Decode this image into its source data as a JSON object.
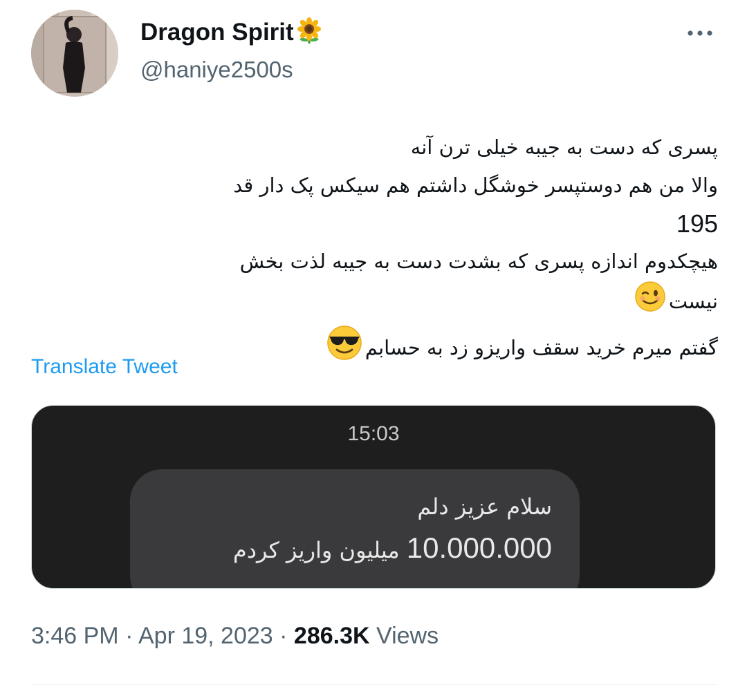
{
  "author": {
    "display_name": "Dragon Spirit",
    "handle": "@haniye2500s",
    "name_emoji": "sunflower-icon"
  },
  "tweet": {
    "lines": [
      "پسری که دست به جیبه خیلی ترن آنه",
      "والا من هم دوستپسر خوشگل داشتم هم سیکس پک دار قد",
      "195",
      "هیچکدوم اندازه پسری که  بشدت دست به جیبه لذت بخش",
      "نیست",
      "گفتم میرم خرید سقف واریزو  زد به حسابم"
    ],
    "emojis": [
      "winking-face-icon",
      "smiling-face-with-sunglasses-icon"
    ],
    "translate_label": "Translate Tweet"
  },
  "media": {
    "time": "15:03",
    "message_line1": "سلام عزیز دلم",
    "message_amount": "10.000.000",
    "message_rest": "میلیون واریز کردم"
  },
  "meta": {
    "time": "3:46 PM",
    "separator": "·",
    "date": "Apr 19, 2023",
    "views_count": "286.3K",
    "views_label": "Views"
  },
  "colors": {
    "link": "#1d9bf0",
    "secondary_text": "#536471",
    "primary_text": "#0f1419",
    "media_background": "#1e1e1f",
    "bubble_background": "#3a3a3c"
  }
}
